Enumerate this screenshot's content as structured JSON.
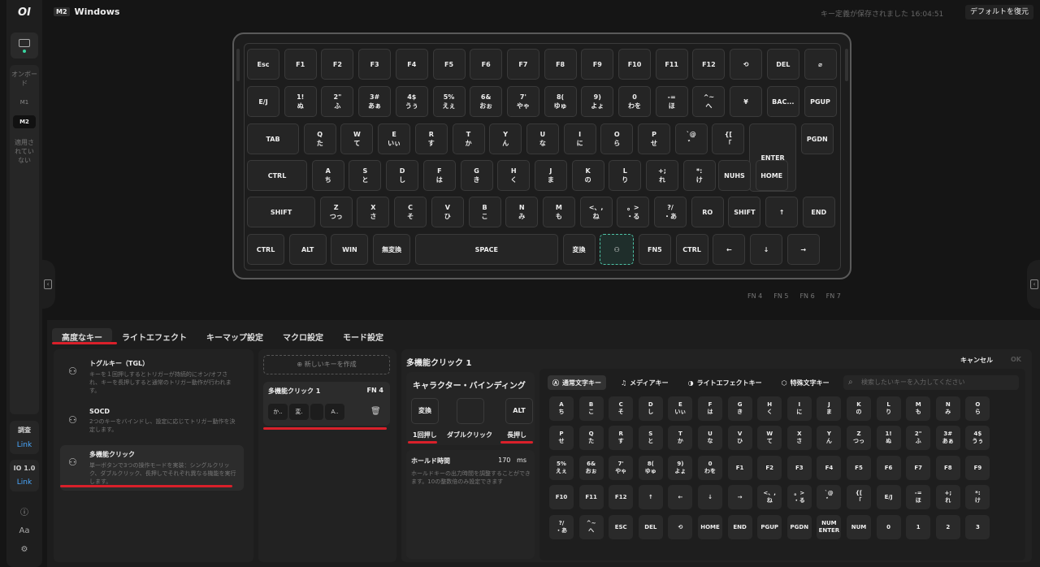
{
  "sidebar": {
    "logo": "OI",
    "onboard_label": "オンボード",
    "m1": "M1",
    "m2": "M2",
    "not_applied": "適用されていない",
    "calib": {
      "title": "調査",
      "link": "Link"
    },
    "io": {
      "title": "IO 1.0",
      "link": "Link"
    },
    "icons": [
      "info-icon",
      "font-icon",
      "gear-icon"
    ],
    "font_glyph": "Aa"
  },
  "header": {
    "badge": "M2",
    "title": "Windows",
    "saved_text": "キー定義が保存されました 16:04:51",
    "restore_label": "デフォルトを復元"
  },
  "keyboard": {
    "rows": [
      [
        [
          "Esc",
          ""
        ],
        [
          "F1",
          ""
        ],
        [
          "F2",
          ""
        ],
        [
          "F3",
          ""
        ],
        [
          "F4",
          ""
        ],
        [
          "F5",
          ""
        ],
        [
          "F6",
          ""
        ],
        [
          "F7",
          ""
        ],
        [
          "F8",
          ""
        ],
        [
          "F9",
          ""
        ],
        [
          "F10",
          ""
        ],
        [
          "F11",
          ""
        ],
        [
          "F12",
          ""
        ],
        [
          "⟲",
          ""
        ],
        [
          "DEL",
          ""
        ],
        [
          "⌀",
          ""
        ]
      ],
      [
        [
          "E/J",
          ""
        ],
        [
          "1!",
          "ぬ"
        ],
        [
          "2\"",
          "ふ"
        ],
        [
          "3#",
          "あぁ"
        ],
        [
          "4$",
          "うぅ"
        ],
        [
          "5%",
          "えぇ"
        ],
        [
          "6&",
          "おぉ"
        ],
        [
          "7'",
          "やゃ"
        ],
        [
          "8(",
          "ゆゅ"
        ],
        [
          "9)",
          "よょ"
        ],
        [
          "0",
          "わを"
        ],
        [
          "-=",
          "ほ"
        ],
        [
          "^~",
          "へ"
        ],
        [
          "¥",
          ""
        ],
        [
          "BAC...",
          ""
        ],
        [
          "PGUP",
          ""
        ]
      ],
      [
        [
          "TAB",
          ""
        ],
        [
          "Q",
          "た"
        ],
        [
          "W",
          "て"
        ],
        [
          "E",
          "いぃ"
        ],
        [
          "R",
          "す"
        ],
        [
          "T",
          "か"
        ],
        [
          "Y",
          "ん"
        ],
        [
          "U",
          "な"
        ],
        [
          "I",
          "に"
        ],
        [
          "O",
          "ら"
        ],
        [
          "P",
          "せ"
        ],
        [
          "`@",
          "゛"
        ],
        [
          "{[",
          "「"
        ],
        [
          "ENTER",
          ""
        ],
        [
          "PGDN",
          ""
        ]
      ],
      [
        [
          "CTRL",
          ""
        ],
        [
          "A",
          "ち"
        ],
        [
          "S",
          "と"
        ],
        [
          "D",
          "し"
        ],
        [
          "F",
          "は"
        ],
        [
          "G",
          "き"
        ],
        [
          "H",
          "く"
        ],
        [
          "J",
          "ま"
        ],
        [
          "K",
          "の"
        ],
        [
          "L",
          "り"
        ],
        [
          "+;",
          "れ"
        ],
        [
          "*:",
          "け"
        ],
        [
          "NUHS",
          ""
        ],
        [
          "HOME",
          ""
        ]
      ],
      [
        [
          "SHIFT",
          ""
        ],
        [
          "Z",
          "つっ"
        ],
        [
          "X",
          "さ"
        ],
        [
          "C",
          "そ"
        ],
        [
          "V",
          "ひ"
        ],
        [
          "B",
          "こ"
        ],
        [
          "N",
          "み"
        ],
        [
          "M",
          "も"
        ],
        [
          "<、,",
          "ね"
        ],
        [
          "。>",
          "・る"
        ],
        [
          "?/",
          "・あ"
        ],
        [
          "RO",
          ""
        ],
        [
          "SHIFT",
          ""
        ],
        [
          "↑",
          ""
        ],
        [
          "END",
          ""
        ]
      ],
      [
        [
          "CTRL",
          ""
        ],
        [
          "ALT",
          ""
        ],
        [
          "WIN",
          ""
        ],
        [
          "無変換",
          ""
        ],
        [
          "SPACE",
          ""
        ],
        [
          "変換",
          ""
        ],
        [
          "⚇",
          ""
        ],
        [
          "FN5",
          ""
        ],
        [
          "CTRL",
          ""
        ],
        [
          "←",
          ""
        ],
        [
          "↓",
          ""
        ],
        [
          "→",
          ""
        ]
      ]
    ]
  },
  "fn_layers": [
    "FN 4",
    "FN 5",
    "FN 6",
    "FN 7"
  ],
  "tabs": [
    "高度なキー",
    "ライトエフェクト",
    "キーマップ設定",
    "マクロ設定",
    "モード設定"
  ],
  "advanced": [
    {
      "title": "トグルキー（TGL）",
      "desc": "キーを１回押しするとトリガーが持続的にオン/オフされ、キーを長押しすると通常のトリガー動作が行われます。"
    },
    {
      "title": "SOCD",
      "desc": "2つのキーをバインドし、設定に応じてトリガー動作を決定します。"
    },
    {
      "title": "多機能クリック",
      "desc": "単一ボタンで3つの操作モードを実装：シングルクリック、ダブルクリック、長押しでそれぞれ異なる機能を実行します。"
    }
  ],
  "macro_list": {
    "new_label": "新しいキーを作成",
    "card_title": "多機能クリック 1",
    "card_fn": "FN 4",
    "slots": [
      "か..",
      "変.",
      "",
      "A.."
    ]
  },
  "editor": {
    "title": "多機能クリック 1",
    "cancel": "キャンセル",
    "ok": "OK",
    "binding_title": "キャラクター・バインディング",
    "slot1": "変換",
    "slot2": "",
    "slot3": "ALT",
    "lbl1": "1回押し",
    "lbl2": "ダブルクリック",
    "lbl3": "長押し",
    "hold_title": "ホールド時間",
    "hold_value": "170",
    "hold_unit": "ms",
    "hold_desc": "ホールドキーの出力時間を調整することができます。10の整数倍のみ設定できます"
  },
  "palette": {
    "categories": [
      "通常文字キー",
      "メディアキー",
      "ライトエフェクトキー",
      "特殊文字キー"
    ],
    "search_placeholder": "検索したいキーを入力してください",
    "rows": [
      [
        [
          "A",
          "ち"
        ],
        [
          "B",
          "こ"
        ],
        [
          "C",
          "そ"
        ],
        [
          "D",
          "し"
        ],
        [
          "E",
          "いぃ"
        ],
        [
          "F",
          "は"
        ],
        [
          "G",
          "き"
        ],
        [
          "H",
          "く"
        ],
        [
          "I",
          "に"
        ],
        [
          "J",
          "ま"
        ],
        [
          "K",
          "の"
        ],
        [
          "L",
          "り"
        ],
        [
          "M",
          "も"
        ],
        [
          "N",
          "み"
        ],
        [
          "O",
          "ら"
        ]
      ],
      [
        [
          "P",
          "せ"
        ],
        [
          "Q",
          "た"
        ],
        [
          "R",
          "す"
        ],
        [
          "S",
          "と"
        ],
        [
          "T",
          "か"
        ],
        [
          "U",
          "な"
        ],
        [
          "V",
          "ひ"
        ],
        [
          "W",
          "て"
        ],
        [
          "X",
          "さ"
        ],
        [
          "Y",
          "ん"
        ],
        [
          "Z",
          "つっ"
        ],
        [
          "1!",
          "ぬ"
        ],
        [
          "2\"",
          "ふ"
        ],
        [
          "3#",
          "あぁ"
        ],
        [
          "4$",
          "うぅ"
        ]
      ],
      [
        [
          "5%",
          "えぇ"
        ],
        [
          "6&",
          "おぉ"
        ],
        [
          "7'",
          "やゃ"
        ],
        [
          "8(",
          "ゆゅ"
        ],
        [
          "9)",
          "よょ"
        ],
        [
          "0",
          "わを"
        ],
        [
          "F1",
          ""
        ],
        [
          "F2",
          ""
        ],
        [
          "F3",
          ""
        ],
        [
          "F4",
          ""
        ],
        [
          "F5",
          ""
        ],
        [
          "F6",
          ""
        ],
        [
          "F7",
          ""
        ],
        [
          "F8",
          ""
        ],
        [
          "F9",
          ""
        ]
      ],
      [
        [
          "F10",
          ""
        ],
        [
          "F11",
          ""
        ],
        [
          "F12",
          ""
        ],
        [
          "↑",
          ""
        ],
        [
          "←",
          ""
        ],
        [
          "↓",
          ""
        ],
        [
          "→",
          ""
        ],
        [
          "<、,",
          "ね"
        ],
        [
          "。>",
          "・る"
        ],
        [
          "`@",
          "゛"
        ],
        [
          "{[",
          "「"
        ],
        [
          "E/J",
          ""
        ],
        [
          "-=",
          "ほ"
        ],
        [
          "+;",
          "れ"
        ],
        [
          "*:",
          "け"
        ]
      ],
      [
        [
          "?/",
          "・あ"
        ],
        [
          "^~",
          "へ"
        ],
        [
          "ESC",
          ""
        ],
        [
          "DEL",
          ""
        ],
        [
          "⟲",
          ""
        ],
        [
          "HOME",
          ""
        ],
        [
          "END",
          ""
        ],
        [
          "PGUP",
          ""
        ],
        [
          "PGDN",
          ""
        ],
        [
          "NUM",
          "ENTER"
        ],
        [
          "NUM",
          ""
        ],
        [
          "0",
          ""
        ],
        [
          "1",
          ""
        ],
        [
          "2",
          ""
        ],
        [
          "3",
          ""
        ]
      ]
    ]
  },
  "colors": {
    "accent": "#4ec2a5",
    "highlight": "#d9202a",
    "link": "#4aa8ff"
  }
}
